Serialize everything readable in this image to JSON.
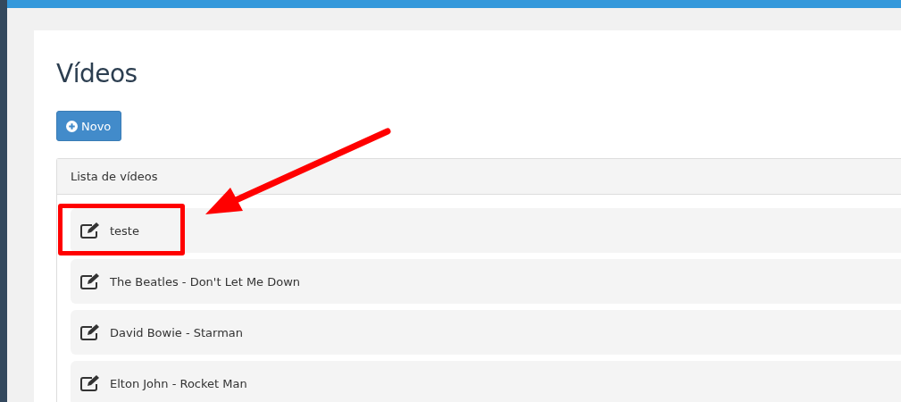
{
  "page": {
    "title": "Vídeos"
  },
  "new_button": {
    "label": "Novo"
  },
  "panel": {
    "heading": "Lista de vídeos",
    "videos": [
      {
        "title": "teste",
        "highlighted": true
      },
      {
        "title": "The Beatles - Don't Let Me Down",
        "highlighted": false
      },
      {
        "title": "David Bowie - Starman",
        "highlighted": false
      },
      {
        "title": "Elton John - Rocket Man",
        "highlighted": false
      }
    ]
  }
}
